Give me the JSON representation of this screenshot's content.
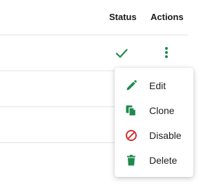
{
  "table": {
    "columns": {
      "status": "Status",
      "actions": "Actions"
    }
  },
  "row": {
    "status_icon": "check-icon",
    "actions_icon": "kebab-menu-icon"
  },
  "colors": {
    "accent_green": "#1e8a4c",
    "disable_red": "#d32f2f"
  },
  "menu": {
    "items": [
      {
        "label": "Edit",
        "icon": "pencil-icon"
      },
      {
        "label": "Clone",
        "icon": "copy-icon"
      },
      {
        "label": "Disable",
        "icon": "block-icon"
      },
      {
        "label": "Delete",
        "icon": "trash-icon"
      }
    ]
  }
}
